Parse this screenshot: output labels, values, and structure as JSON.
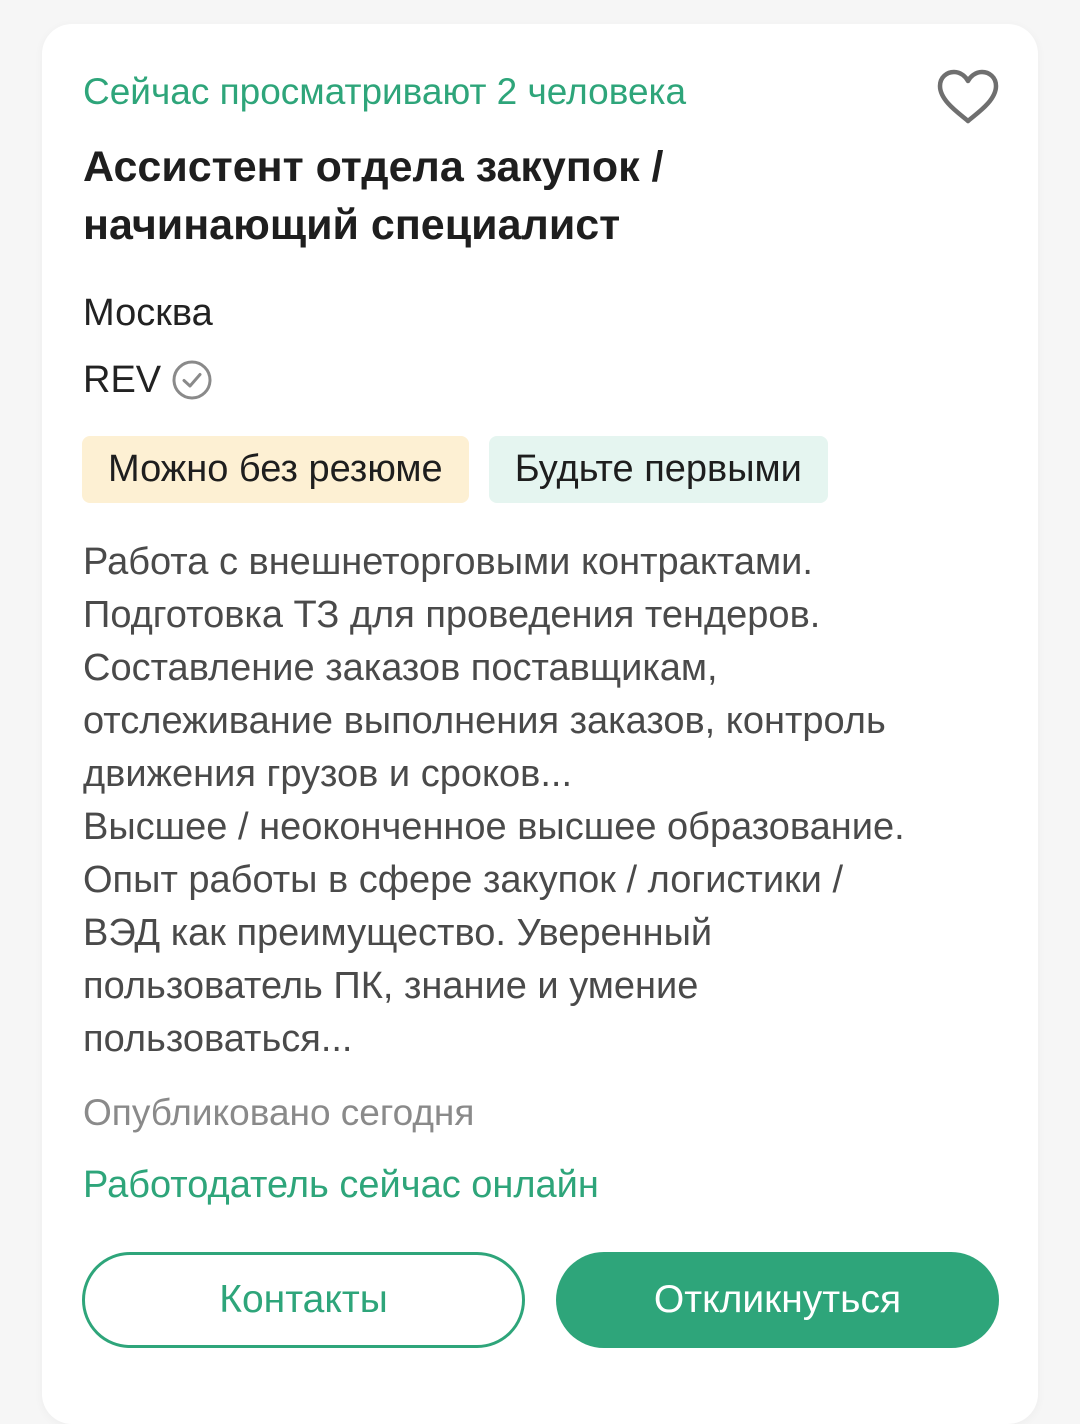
{
  "vacancy": {
    "viewers_text": "Сейчас просматривают 2 человека",
    "title_line1": "Ассистент отдела закупок /",
    "title_line2": "начинающий специалист",
    "city": "Москва",
    "company": "REV",
    "tags": [
      {
        "label": "Можно без резюме",
        "color": "#fdf0d3"
      },
      {
        "label": "Будьте первыми",
        "color": "#e5f5f0"
      }
    ],
    "description": {
      "responsibilities": [
        "Работа с внешнеторговыми контрактами.",
        "Подготовка ТЗ для проведения тендеров.",
        "Составление заказов поставщикам,",
        "отслеживание выполнения заказов, контроль",
        "движения грузов и сроков..."
      ],
      "requirements": [
        "Высшее / неоконченное высшее образование.",
        "Опыт работы в сфере закупок / логистики /",
        "ВЭД как преимущество. Уверенный",
        "пользователь ПК, знание и умение",
        "пользоваться..."
      ]
    },
    "published": "Опубликовано сегодня",
    "employer_status": "Работодатель сейчас онлайн"
  },
  "actions": {
    "contacts_label": "Контакты",
    "respond_label": "Откликнуться"
  },
  "icons": {
    "favorite": "heart-outline-icon",
    "verified": "check-circle-icon"
  },
  "colors": {
    "accent": "#2ea57a",
    "title": "#1e1e1e",
    "text": "#4a4a4a",
    "muted": "#8a8a8a"
  }
}
